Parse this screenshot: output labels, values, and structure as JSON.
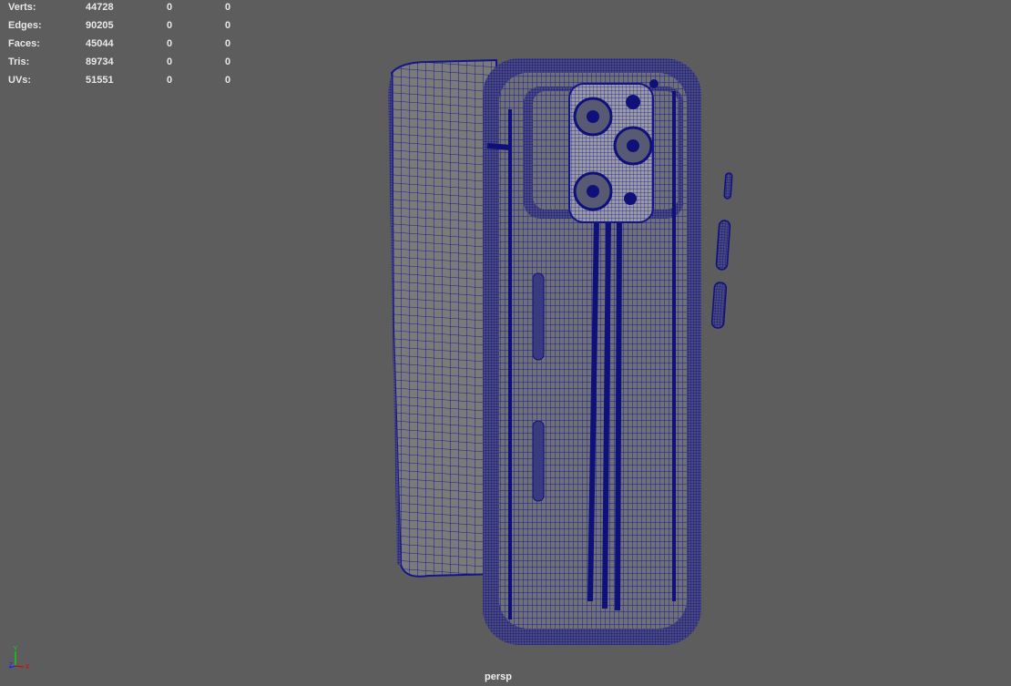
{
  "stats": {
    "rows": [
      {
        "label": "Verts:",
        "total": "44728",
        "selected": "0",
        "extra": "0"
      },
      {
        "label": "Edges:",
        "total": "90205",
        "selected": "0",
        "extra": "0"
      },
      {
        "label": "Faces:",
        "total": "45044",
        "selected": "0",
        "extra": "0"
      },
      {
        "label": "Tris:",
        "total": "89734",
        "selected": "0",
        "extra": "0"
      },
      {
        "label": "UVs:",
        "total": "51551",
        "selected": "0",
        "extra": "0"
      }
    ]
  },
  "viewport": {
    "camera_label": "persp",
    "wire_color": "#15158a",
    "background": "#5d5d5d"
  },
  "axis": {
    "x": "X",
    "y": "Y",
    "z": "Z"
  }
}
